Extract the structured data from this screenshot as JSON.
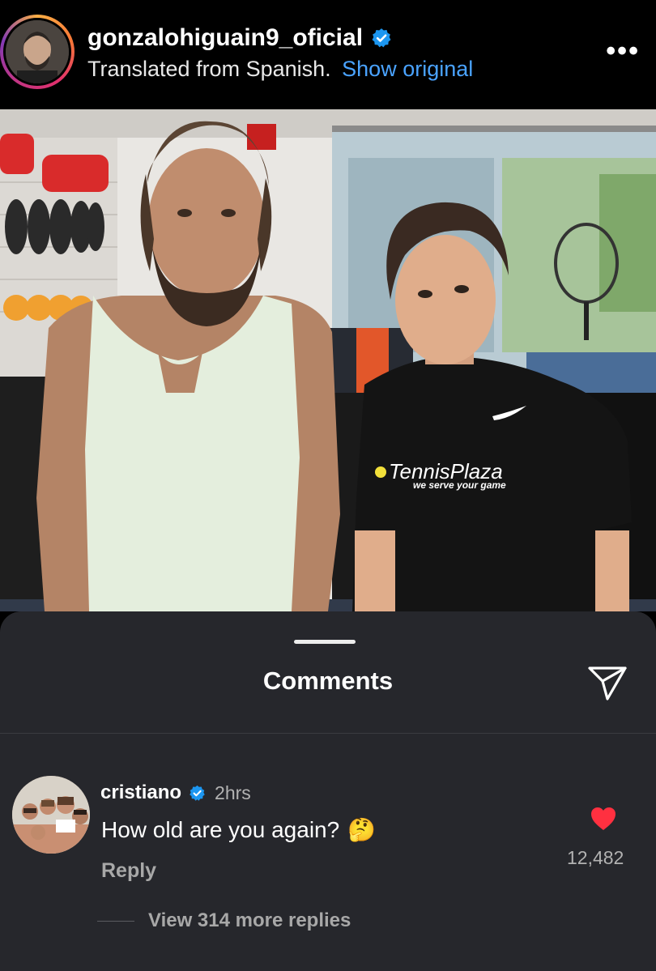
{
  "post": {
    "username": "gonzalohiguain9_oficial",
    "translation_note": "Translated from Spanish.",
    "show_original": "Show original",
    "more_icon": "more-horizontal-icon",
    "more_text": "•••"
  },
  "photo": {
    "shirt_brand": "TennisPlaza",
    "shirt_slogan": "we serve your game",
    "colors": {
      "wall": "#e9e7e3",
      "tank_top": "#e4eedd",
      "shirt": "#141414"
    }
  },
  "comments_sheet": {
    "title": "Comments",
    "send_icon": "send-icon",
    "comment": {
      "author": "cristiano",
      "time": "2hrs",
      "text": "How old are you again?",
      "emoji": "🤔",
      "reply_label": "Reply",
      "like_count": "12,482",
      "liked": true,
      "heart_color": "#ff3040"
    },
    "view_replies": "View 314 more replies"
  },
  "colors": {
    "link": "#4aa3ff",
    "verified": "#1c96f0",
    "sheet_bg": "#26272c"
  }
}
